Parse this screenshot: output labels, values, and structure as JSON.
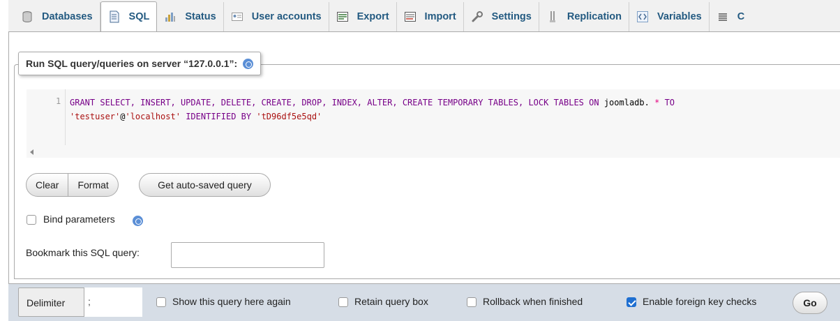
{
  "tabs": [
    {
      "label": "Databases",
      "icon": "database-icon"
    },
    {
      "label": "SQL",
      "icon": "sql-icon"
    },
    {
      "label": "Status",
      "icon": "status-icon"
    },
    {
      "label": "User accounts",
      "icon": "user-accounts-icon"
    },
    {
      "label": "Export",
      "icon": "export-icon"
    },
    {
      "label": "Import",
      "icon": "import-icon"
    },
    {
      "label": "Settings",
      "icon": "wrench-icon"
    },
    {
      "label": "Replication",
      "icon": "replication-icon"
    },
    {
      "label": "Variables",
      "icon": "variables-icon"
    },
    {
      "label": "C",
      "icon": "list-icon"
    }
  ],
  "active_tab": "SQL",
  "panel": {
    "legend": "Run SQL query/queries on server “127.0.0.1”:"
  },
  "editor": {
    "line_number": "1",
    "line1": {
      "kw1": "GRANT SELECT, INSERT, UPDATE, DELETE, CREATE, DROP, INDEX, ALTER, CREATE TEMPORARY TABLES, LOCK TABLES ON",
      "db": "joomladb.",
      "star": "*",
      "to": "TO"
    },
    "line2": {
      "user": "'testuser'",
      "at": "@",
      "host": "'localhost'",
      "ident": "IDENTIFIED BY",
      "pass": "'tD96df5e5qd'"
    }
  },
  "buttons": {
    "clear": "Clear",
    "format": "Format",
    "autosaved": "Get auto-saved query"
  },
  "bind_parameters": {
    "label": "Bind parameters",
    "checked": false
  },
  "bookmark": {
    "label": "Bookmark this SQL query:",
    "value": ""
  },
  "bottom": {
    "delimiter_label": "Delimiter",
    "delimiter_value": ";",
    "show_query_label": "Show this query here again",
    "retain_label": "Retain query box",
    "rollback_label": "Rollback when finished",
    "fk_label": "Enable foreign key checks",
    "fk_checked": true,
    "go_label": "Go"
  },
  "colors": {
    "tab_text": "#235a81",
    "checkbox_checked": "#1f6fd1",
    "bottom_bar": "#d6dde6"
  }
}
